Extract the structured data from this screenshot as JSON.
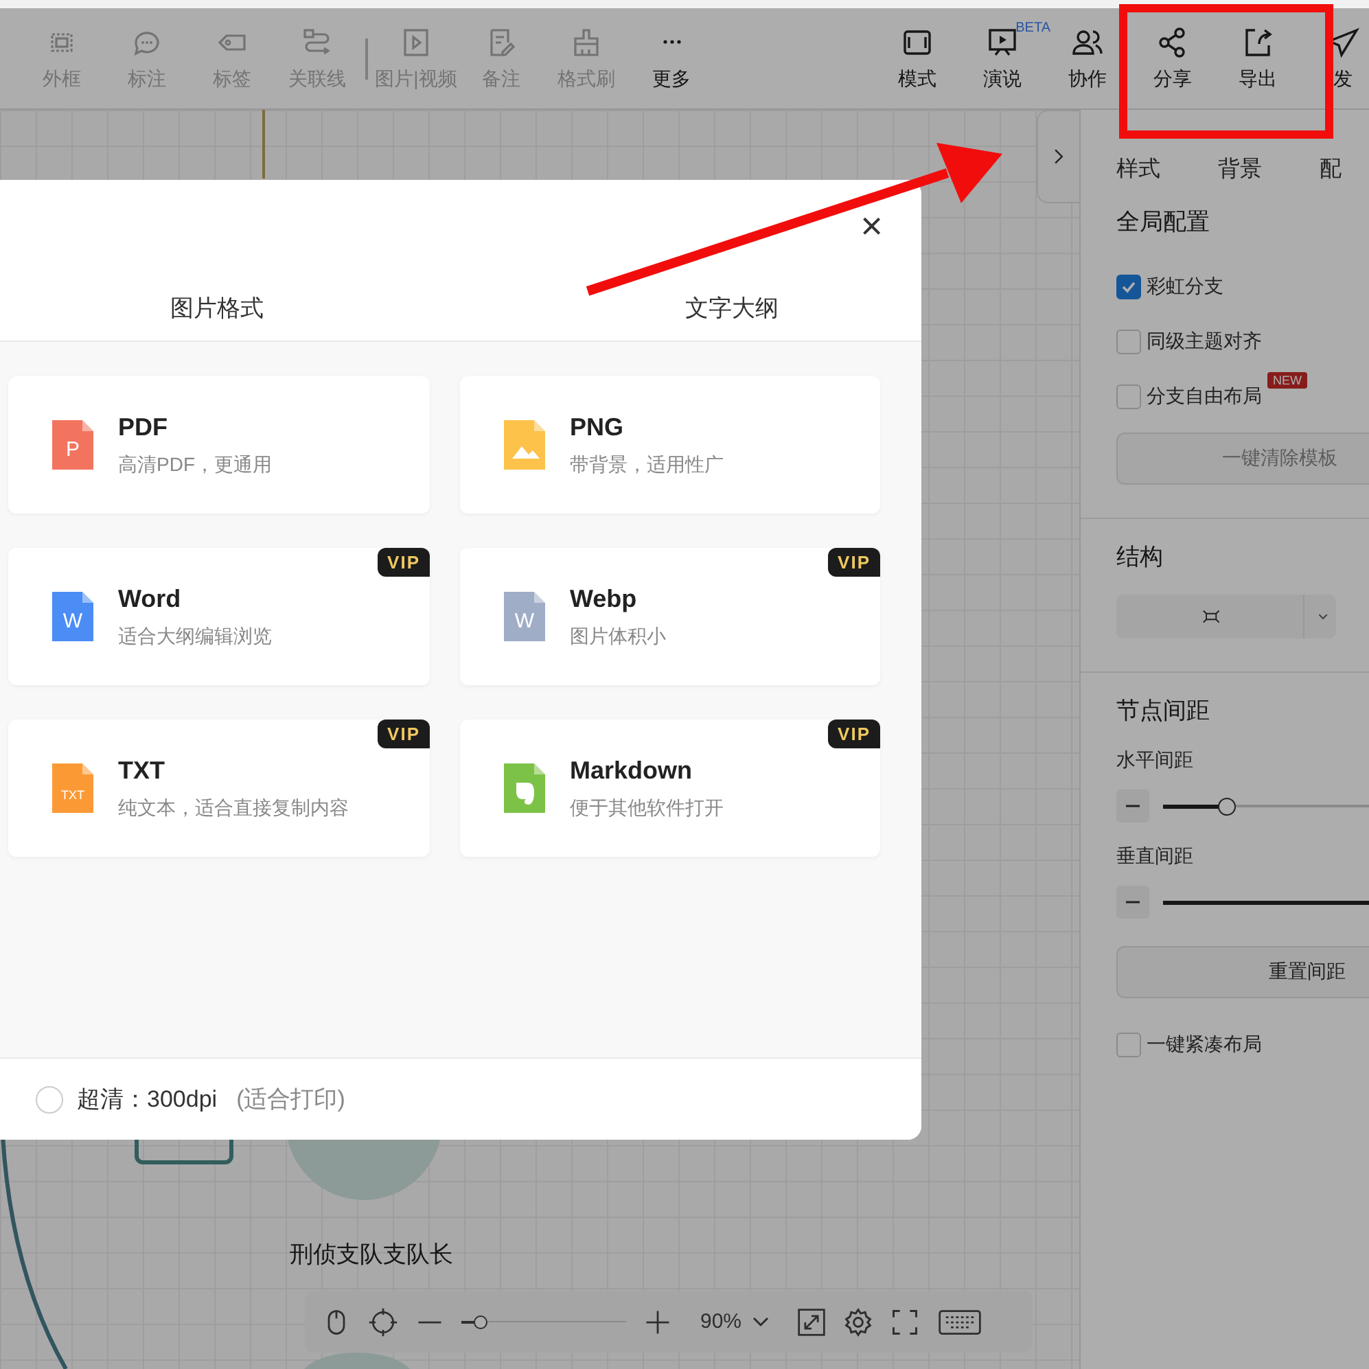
{
  "toolbar": {
    "left": [
      {
        "label": "外框",
        "disabled": true
      },
      {
        "label": "标注",
        "disabled": true
      },
      {
        "label": "标签",
        "disabled": true
      },
      {
        "label": "关联线",
        "disabled": true
      },
      {
        "label": "图片|视频",
        "disabled": true
      },
      {
        "label": "备注",
        "disabled": true
      },
      {
        "label": "格式刷",
        "disabled": true
      },
      {
        "label": "更多",
        "disabled": false
      }
    ],
    "right": [
      {
        "label": "模式"
      },
      {
        "label": "演说",
        "badge": "BETA"
      },
      {
        "label": "协作"
      },
      {
        "label": "分享"
      },
      {
        "label": "导出"
      },
      {
        "label": "发"
      }
    ]
  },
  "canvas": {
    "node_label": "刑侦支队支队长"
  },
  "zoom_bar": {
    "level": 0.12,
    "zoom": "90%"
  },
  "panel": {
    "tabs": [
      "样式",
      "背景",
      "配"
    ],
    "global": {
      "title": "全局配置",
      "options": [
        {
          "label": "彩虹分支",
          "checked": true
        },
        {
          "label": "同级主题对齐",
          "checked": false
        },
        {
          "label": "分支自由布局",
          "checked": false,
          "badge": "NEW"
        }
      ],
      "clear_button": "一键清除模板"
    },
    "structure": {
      "title": "结构"
    },
    "spacing": {
      "title": "节点间距",
      "sliders": [
        {
          "label": "水平间距",
          "level": 0.3
        },
        {
          "label": "垂直间距",
          "level": 1
        }
      ],
      "reset_button": "重置间距",
      "compact": {
        "label": "一键紧凑布局",
        "checked": false
      }
    }
  },
  "export_dialog": {
    "close": "×",
    "tabs": [
      {
        "label": "图片格式",
        "selected": false
      },
      {
        "label": "文字大纲",
        "selected": false
      }
    ],
    "formats": [
      {
        "kind": "pdf",
        "icon_text": "P",
        "name": "PDF",
        "desc": "高清PDF，更通用"
      },
      {
        "kind": "png",
        "name": "PNG",
        "desc": "带背景，适用性广"
      },
      {
        "kind": "word",
        "icon_text": "W",
        "name": "Word",
        "desc": "适合大纲编辑浏览",
        "vip": "VIP"
      },
      {
        "kind": "webp",
        "icon_text": "W",
        "name": "Webp",
        "desc": "图片体积小",
        "vip": "VIP"
      },
      {
        "kind": "txt",
        "icon_text": "TXT",
        "name": "TXT",
        "desc": "纯文本，适合直接复制内容",
        "vip": "VIP"
      },
      {
        "kind": "markdown",
        "name": "Markdown",
        "desc": "便于其他软件打开",
        "vip": "VIP"
      }
    ],
    "quality": {
      "label": "超清：300dpi",
      "hint": "(适合打印)",
      "selected": false
    }
  }
}
